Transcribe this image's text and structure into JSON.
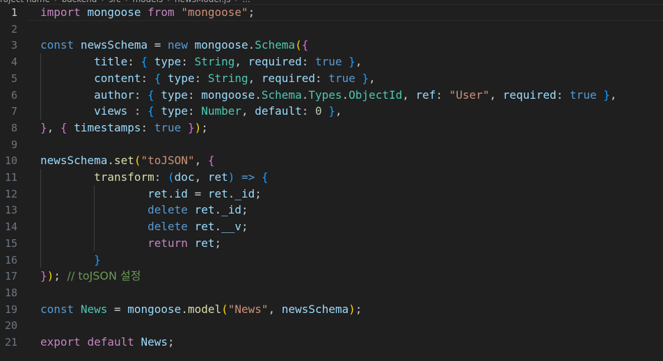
{
  "breadcrumb": {
    "items": [
      "roject name",
      "backend",
      "src",
      "models",
      "newsModel.js",
      "..."
    ],
    "separator": "›"
  },
  "editor": {
    "current_line": 1,
    "lines": [
      {
        "n": "1",
        "tokens": [
          [
            "kw",
            "import"
          ],
          [
            "pl",
            " "
          ],
          [
            "var",
            "mongoose"
          ],
          [
            "pl",
            " "
          ],
          [
            "kw",
            "from"
          ],
          [
            "pl",
            " "
          ],
          [
            "str",
            "\"mongoose\""
          ],
          [
            "pl",
            ";"
          ]
        ]
      },
      {
        "n": "2",
        "tokens": []
      },
      {
        "n": "3",
        "tokens": [
          [
            "st",
            "const"
          ],
          [
            "pl",
            " "
          ],
          [
            "var",
            "newsSchema"
          ],
          [
            "pl",
            " = "
          ],
          [
            "st",
            "new"
          ],
          [
            "pl",
            " "
          ],
          [
            "var",
            "mongoose"
          ],
          [
            "pl",
            "."
          ],
          [
            "cls",
            "Schema"
          ],
          [
            "b1",
            "("
          ],
          [
            "b2",
            "{"
          ]
        ]
      },
      {
        "n": "4",
        "tokens": [
          [
            "pl",
            "        "
          ],
          [
            "var",
            "title"
          ],
          [
            "pl",
            ": "
          ],
          [
            "b3",
            "{"
          ],
          [
            "pl",
            " "
          ],
          [
            "var",
            "type"
          ],
          [
            "pl",
            ": "
          ],
          [
            "cls",
            "String"
          ],
          [
            "pl",
            ", "
          ],
          [
            "var",
            "required"
          ],
          [
            "pl",
            ": "
          ],
          [
            "st",
            "true"
          ],
          [
            "pl",
            " "
          ],
          [
            "b3",
            "}"
          ],
          [
            "pl",
            ","
          ]
        ]
      },
      {
        "n": "5",
        "tokens": [
          [
            "pl",
            "        "
          ],
          [
            "var",
            "content"
          ],
          [
            "pl",
            ": "
          ],
          [
            "b3",
            "{"
          ],
          [
            "pl",
            " "
          ],
          [
            "var",
            "type"
          ],
          [
            "pl",
            ": "
          ],
          [
            "cls",
            "String"
          ],
          [
            "pl",
            ", "
          ],
          [
            "var",
            "required"
          ],
          [
            "pl",
            ": "
          ],
          [
            "st",
            "true"
          ],
          [
            "pl",
            " "
          ],
          [
            "b3",
            "}"
          ],
          [
            "pl",
            ","
          ]
        ]
      },
      {
        "n": "6",
        "tokens": [
          [
            "pl",
            "        "
          ],
          [
            "var",
            "author"
          ],
          [
            "pl",
            ": "
          ],
          [
            "b3",
            "{"
          ],
          [
            "pl",
            " "
          ],
          [
            "var",
            "type"
          ],
          [
            "pl",
            ": "
          ],
          [
            "var",
            "mongoose"
          ],
          [
            "pl",
            "."
          ],
          [
            "cls",
            "Schema"
          ],
          [
            "pl",
            "."
          ],
          [
            "cls",
            "Types"
          ],
          [
            "pl",
            "."
          ],
          [
            "cls",
            "ObjectId"
          ],
          [
            "pl",
            ", "
          ],
          [
            "var",
            "ref"
          ],
          [
            "pl",
            ": "
          ],
          [
            "str",
            "\"User\""
          ],
          [
            "pl",
            ", "
          ],
          [
            "var",
            "required"
          ],
          [
            "pl",
            ": "
          ],
          [
            "st",
            "true"
          ],
          [
            "pl",
            " "
          ],
          [
            "b3",
            "}"
          ],
          [
            "pl",
            ","
          ]
        ]
      },
      {
        "n": "7",
        "tokens": [
          [
            "pl",
            "        "
          ],
          [
            "var",
            "views"
          ],
          [
            "pl",
            " : "
          ],
          [
            "b3",
            "{"
          ],
          [
            "pl",
            " "
          ],
          [
            "var",
            "type"
          ],
          [
            "pl",
            ": "
          ],
          [
            "cls",
            "Number"
          ],
          [
            "pl",
            ", "
          ],
          [
            "var",
            "default"
          ],
          [
            "pl",
            ": "
          ],
          [
            "num",
            "0"
          ],
          [
            "pl",
            " "
          ],
          [
            "b3",
            "}"
          ],
          [
            "pl",
            ","
          ]
        ]
      },
      {
        "n": "8",
        "tokens": [
          [
            "b2",
            "}"
          ],
          [
            "pl",
            ", "
          ],
          [
            "b2",
            "{"
          ],
          [
            "pl",
            " "
          ],
          [
            "var",
            "timestamps"
          ],
          [
            "pl",
            ": "
          ],
          [
            "st",
            "true"
          ],
          [
            "pl",
            " "
          ],
          [
            "b2",
            "}"
          ],
          [
            "b1",
            ")"
          ],
          [
            "pl",
            ";"
          ]
        ]
      },
      {
        "n": "9",
        "tokens": []
      },
      {
        "n": "10",
        "tokens": [
          [
            "var",
            "newsSchema"
          ],
          [
            "pl",
            "."
          ],
          [
            "fn",
            "set"
          ],
          [
            "b1",
            "("
          ],
          [
            "str",
            "\"toJSON\""
          ],
          [
            "pl",
            ", "
          ],
          [
            "b2",
            "{"
          ]
        ]
      },
      {
        "n": "11",
        "tokens": [
          [
            "pl",
            "        "
          ],
          [
            "fn",
            "transform"
          ],
          [
            "pl",
            ": "
          ],
          [
            "b3",
            "("
          ],
          [
            "var",
            "doc"
          ],
          [
            "pl",
            ", "
          ],
          [
            "var",
            "ret"
          ],
          [
            "b3",
            ")"
          ],
          [
            "pl",
            " "
          ],
          [
            "st",
            "=>"
          ],
          [
            "pl",
            " "
          ],
          [
            "b3",
            "{"
          ]
        ]
      },
      {
        "n": "12",
        "tokens": [
          [
            "pl",
            "                "
          ],
          [
            "var",
            "ret"
          ],
          [
            "pl",
            "."
          ],
          [
            "var",
            "id"
          ],
          [
            "pl",
            " = "
          ],
          [
            "var",
            "ret"
          ],
          [
            "pl",
            "."
          ],
          [
            "var",
            "_id"
          ],
          [
            "pl",
            ";"
          ]
        ]
      },
      {
        "n": "13",
        "tokens": [
          [
            "pl",
            "                "
          ],
          [
            "st",
            "delete"
          ],
          [
            "pl",
            " "
          ],
          [
            "var",
            "ret"
          ],
          [
            "pl",
            "."
          ],
          [
            "var",
            "_id"
          ],
          [
            "pl",
            ";"
          ]
        ]
      },
      {
        "n": "14",
        "tokens": [
          [
            "pl",
            "                "
          ],
          [
            "st",
            "delete"
          ],
          [
            "pl",
            " "
          ],
          [
            "var",
            "ret"
          ],
          [
            "pl",
            "."
          ],
          [
            "var",
            "__v"
          ],
          [
            "pl",
            ";"
          ]
        ]
      },
      {
        "n": "15",
        "tokens": [
          [
            "pl",
            "                "
          ],
          [
            "kw",
            "return"
          ],
          [
            "pl",
            " "
          ],
          [
            "var",
            "ret"
          ],
          [
            "pl",
            ";"
          ]
        ]
      },
      {
        "n": "16",
        "tokens": [
          [
            "pl",
            "        "
          ],
          [
            "b3",
            "}"
          ]
        ]
      },
      {
        "n": "17",
        "tokens": [
          [
            "b2",
            "}"
          ],
          [
            "b1",
            ")"
          ],
          [
            "pl",
            "; "
          ],
          [
            "cm",
            "// toJSON 설정"
          ]
        ]
      },
      {
        "n": "18",
        "tokens": []
      },
      {
        "n": "19",
        "tokens": [
          [
            "st",
            "const"
          ],
          [
            "pl",
            " "
          ],
          [
            "cls",
            "News"
          ],
          [
            "pl",
            " = "
          ],
          [
            "var",
            "mongoose"
          ],
          [
            "pl",
            "."
          ],
          [
            "fn",
            "model"
          ],
          [
            "b1",
            "("
          ],
          [
            "str",
            "\"News\""
          ],
          [
            "pl",
            ", "
          ],
          [
            "var",
            "newsSchema"
          ],
          [
            "b1",
            ")"
          ],
          [
            "pl",
            ";"
          ]
        ]
      },
      {
        "n": "20",
        "tokens": []
      },
      {
        "n": "21",
        "tokens": [
          [
            "kw",
            "export"
          ],
          [
            "pl",
            " "
          ],
          [
            "kw",
            "default"
          ],
          [
            "pl",
            " "
          ],
          [
            "var",
            "News"
          ],
          [
            "pl",
            ";"
          ]
        ]
      }
    ]
  }
}
